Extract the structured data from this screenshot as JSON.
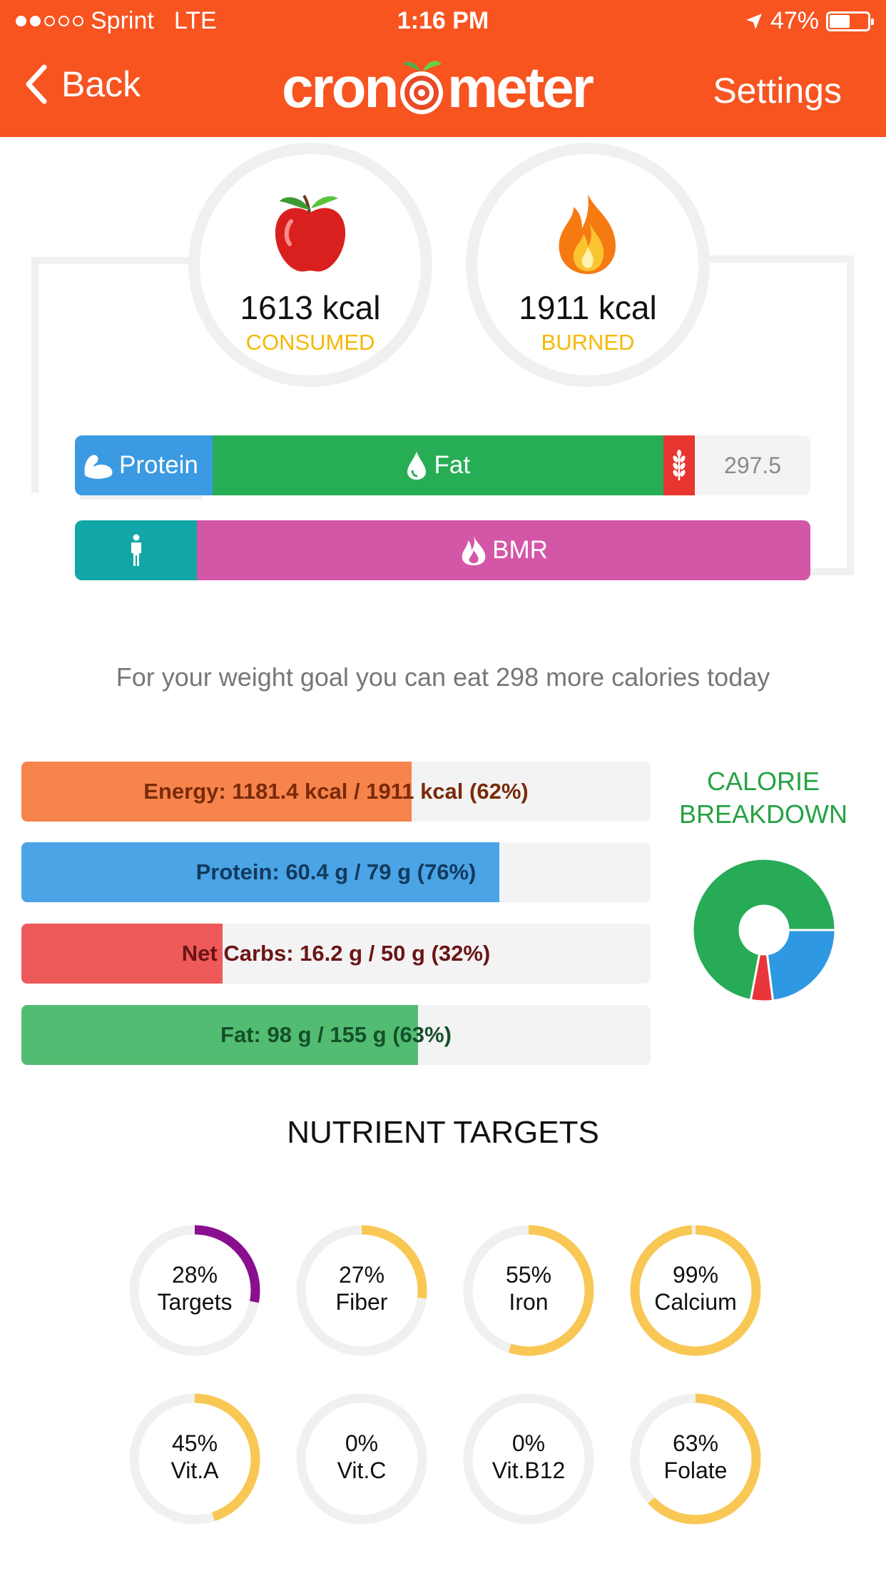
{
  "status_bar": {
    "carrier": "Sprint",
    "network": "LTE",
    "time": "1:16 PM",
    "battery": "47%"
  },
  "nav": {
    "back_label": "Back",
    "app_title": "cronometer",
    "settings_label": "Settings"
  },
  "energy": {
    "consumed_value": "1613 kcal",
    "consumed_label": "CONSUMED",
    "burned_value": "1911 kcal",
    "burned_label": "BURNED"
  },
  "macro_bar": {
    "protein_label": "Protein",
    "fat_label": "Fat",
    "remaining_value": "297.5",
    "protein_fraction": 0.187,
    "fat_fraction": 0.613,
    "carbs_fraction": 0.043,
    "colors": {
      "protein": "#3b9ae1",
      "fat": "#27ae55",
      "carbs": "#e8352f"
    }
  },
  "burn_bar": {
    "bmr_label": "BMR",
    "activity_fraction": 0.166,
    "colors": {
      "activity": "#12a6a6",
      "bmr": "#d457a7"
    }
  },
  "goal_message": "For your weight goal you can eat 298 more calories today",
  "targets": [
    {
      "label": "Energy: 1181.4 kcal / 1911 kcal (62%)",
      "fraction": 0.62,
      "color": "#f6844c",
      "text_color": "#7a2a08"
    },
    {
      "label": "Protein: 60.4 g / 79 g (76%)",
      "fraction": 0.76,
      "color": "#4aa4e6",
      "text_color": "#123a5c"
    },
    {
      "label": "Net Carbs: 16.2 g / 50 g (32%)",
      "fraction": 0.32,
      "color": "#ee5a5a",
      "text_color": "#6b1414"
    },
    {
      "label": "Fat: 98 g / 155 g (63%)",
      "fraction": 0.63,
      "color": "#52bd72",
      "text_color": "#14502a"
    }
  ],
  "calorie_breakdown": {
    "title_line1": "CALORIE",
    "title_line2": "BREAKDOWN",
    "slices": [
      {
        "fraction": 0.23,
        "color": "#2e98e2"
      },
      {
        "fraction": 0.05,
        "color": "#e8353a"
      },
      {
        "fraction": 0.72,
        "color": "#27ab56"
      }
    ]
  },
  "nutrient_targets": {
    "title": "NUTRIENT TARGETS",
    "items": [
      {
        "pct": "28%",
        "name": "Targets",
        "fraction": 0.28,
        "color": "#8a0f8e"
      },
      {
        "pct": "27%",
        "name": "Fiber",
        "fraction": 0.27,
        "color": "#f9c754"
      },
      {
        "pct": "55%",
        "name": "Iron",
        "fraction": 0.55,
        "color": "#f9c754"
      },
      {
        "pct": "99%",
        "name": "Calcium",
        "fraction": 0.99,
        "color": "#f9c754"
      },
      {
        "pct": "45%",
        "name": "Vit.A",
        "fraction": 0.45,
        "color": "#f9c754"
      },
      {
        "pct": "0%",
        "name": "Vit.C",
        "fraction": 0,
        "color": "#f9c754"
      },
      {
        "pct": "0%",
        "name": "Vit.B12",
        "fraction": 0,
        "color": "#f9c754"
      },
      {
        "pct": "63%",
        "name": "Folate",
        "fraction": 0.63,
        "color": "#f9c754"
      }
    ]
  }
}
